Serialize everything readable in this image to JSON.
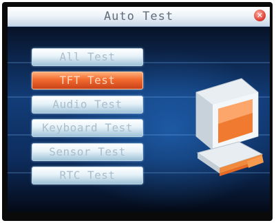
{
  "window": {
    "title": "Auto Test",
    "close_glyph": "✕"
  },
  "menu": {
    "items": [
      {
        "label": "All Test",
        "selected": false
      },
      {
        "label": "TFT Test",
        "selected": true
      },
      {
        "label": "Audio Test",
        "selected": false
      },
      {
        "label": "Keyboard Test",
        "selected": false
      },
      {
        "label": "Sensor Test",
        "selected": false
      },
      {
        "label": "RTC Test",
        "selected": false
      }
    ]
  },
  "illustration": {
    "icon": "computer-icon"
  },
  "colors": {
    "selected_item": "#f26a2e",
    "item": "#e6f2f8",
    "background": "#123c77"
  }
}
